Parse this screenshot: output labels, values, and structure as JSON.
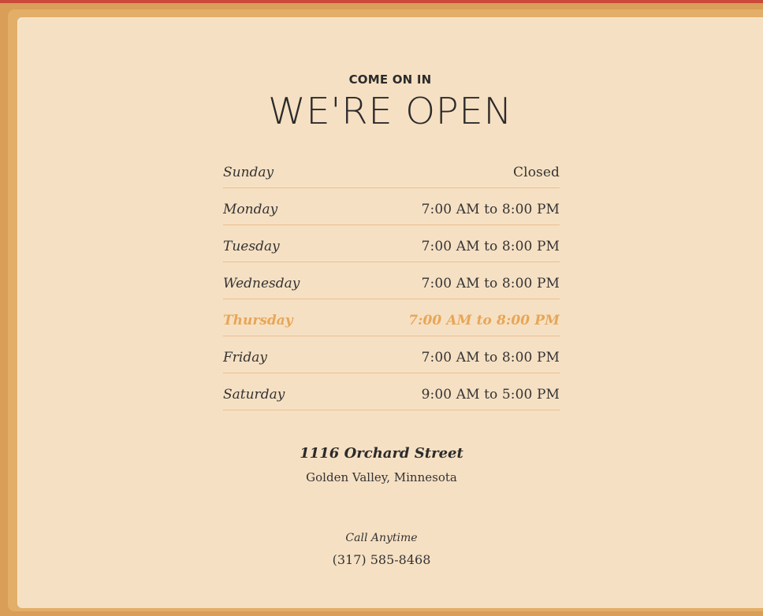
{
  "header": {
    "eyebrow": "COME ON IN",
    "title": "WE'RE OPEN"
  },
  "hours": [
    {
      "day": "Sunday",
      "time": "Closed",
      "today": false
    },
    {
      "day": "Monday",
      "time": "7:00 AM to 8:00 PM",
      "today": false
    },
    {
      "day": "Tuesday",
      "time": "7:00 AM to 8:00 PM",
      "today": false
    },
    {
      "day": "Wednesday",
      "time": "7:00 AM to 8:00 PM",
      "today": false
    },
    {
      "day": "Thursday",
      "time": "7:00 AM to 8:00 PM",
      "today": true
    },
    {
      "day": "Friday",
      "time": "7:00 AM to 8:00 PM",
      "today": false
    },
    {
      "day": "Saturday",
      "time": "9:00 AM to 5:00 PM",
      "today": false
    }
  ],
  "address": {
    "street": "1116 Orchard Street",
    "city": "Golden Valley, Minnesota"
  },
  "contact": {
    "label": "Call Anytime",
    "phone": "(317) 585-8468"
  },
  "colors": {
    "frame": "#d99e58",
    "card": "#f6e0c3",
    "highlight": "#e7a657",
    "divider": "#e8c08e",
    "top_strip": "#c94a3a"
  }
}
